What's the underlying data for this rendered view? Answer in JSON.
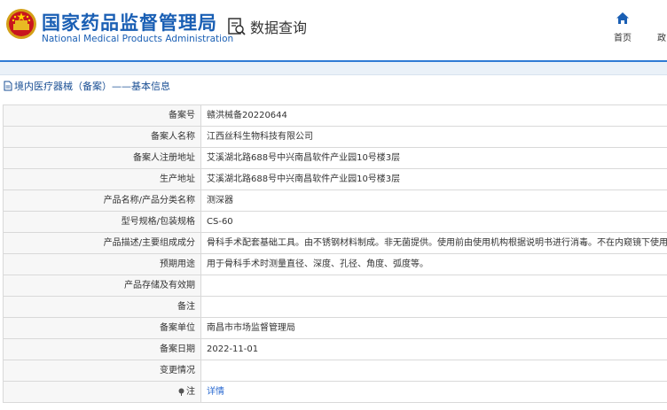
{
  "brand": {
    "name_cn": "国家药品监督管理局",
    "name_en": "National Medical Products Administration"
  },
  "header": {
    "query_label": "数据查询",
    "nav_home": "首页",
    "nav_next_partial": "政"
  },
  "section": {
    "title": "境内医疗器械（备案）——基本信息"
  },
  "rows": [
    {
      "label": "备案号",
      "value": "赣洪械备20220644"
    },
    {
      "label": "备案人名称",
      "value": "江西丝科生物科技有限公司"
    },
    {
      "label": "备案人注册地址",
      "value": "艾溪湖北路688号中兴南昌软件产业园10号楼3层"
    },
    {
      "label": "生产地址",
      "value": "艾溪湖北路688号中兴南昌软件产业园10号楼3层"
    },
    {
      "label": "产品名称/产品分类名称",
      "value": "测深器"
    },
    {
      "label": "型号规格/包装规格",
      "value": "CS-60"
    },
    {
      "label": "产品描述/主要组成成分",
      "value": "骨科手术配套基础工具。由不锈钢材料制成。非无菌提供。使用前由使用机构根据说明书进行消毒。不在内窥镜下使用。"
    },
    {
      "label": "预期用途",
      "value": "用于骨科手术时测量直径、深度、孔径、角度、弧度等。"
    },
    {
      "label": "产品存储及有效期",
      "value": ""
    },
    {
      "label": "备注",
      "value": ""
    },
    {
      "label": "备案单位",
      "value": "南昌市市场监督管理局"
    },
    {
      "label": "备案日期",
      "value": "2022-11-01"
    },
    {
      "label": "变更情况",
      "value": ""
    }
  ],
  "note_row": {
    "label": "注",
    "link": "详情"
  },
  "colors": {
    "brand_blue": "#1a5fb4",
    "header_rule": "#2f7bd4",
    "link": "#2a6ad1"
  }
}
